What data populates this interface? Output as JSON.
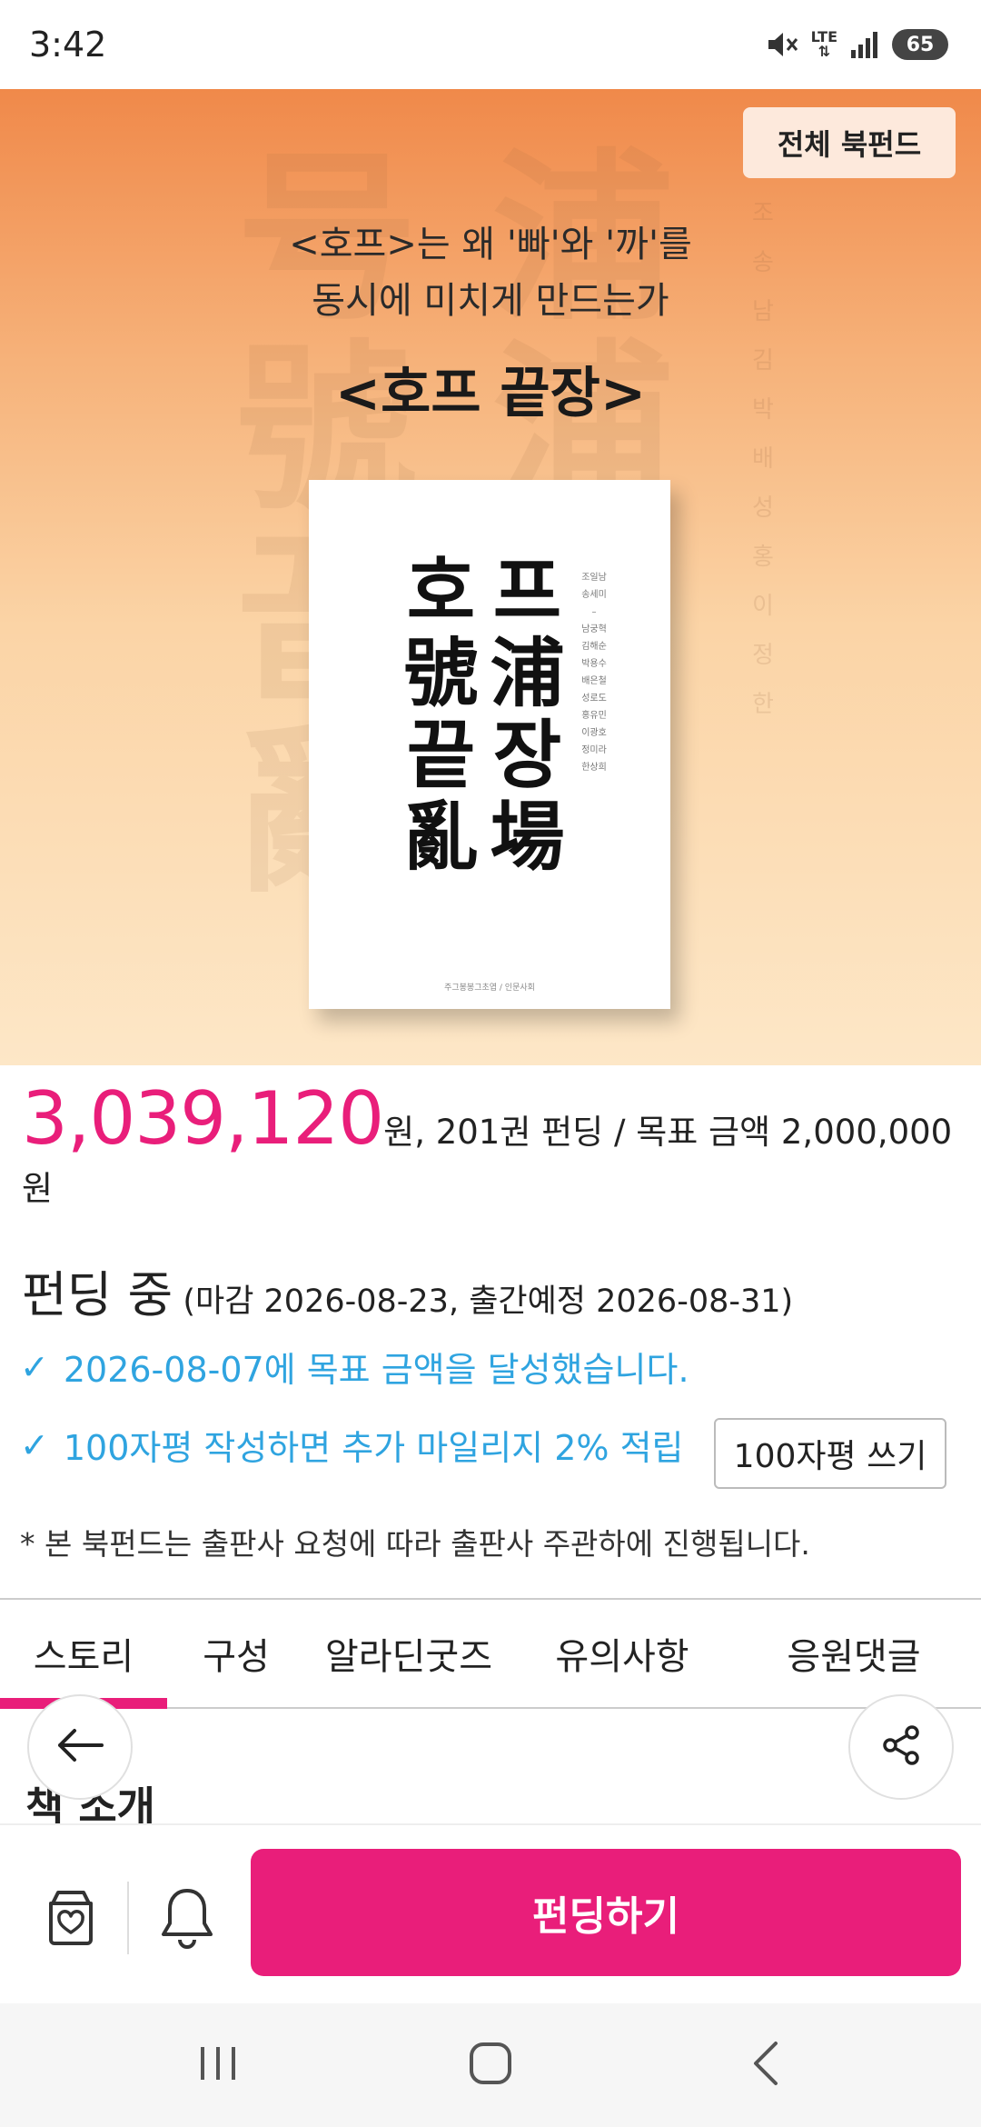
{
  "status_bar": {
    "time": "3:42",
    "network": "LTE",
    "battery": "65"
  },
  "hero": {
    "fund_all_button": "전체 북펀드",
    "subtitle_line1": "<호프>는 왜 '빠'와 '까'를",
    "subtitle_line2": "동시에 미치게 만드는가",
    "title": "<호프 끝장>",
    "cover": {
      "title_chars": [
        "호",
        "프",
        "號",
        "浦",
        "끝",
        "장",
        "亂",
        "場"
      ],
      "authors": [
        "조일남",
        "송세미",
        "남궁혁",
        "김해순",
        "박용수",
        "배은철",
        "성로도",
        "홍유민",
        "이광호",
        "정미라",
        "한상희"
      ],
      "publisher": "주그봉봉그초엽 / 인문사회"
    }
  },
  "funding": {
    "amount": "3,039,120",
    "amount_suffix": "원, 201권 펀딩 / 목표 금액 2,000,000원",
    "status": "펀딩 중",
    "dates": "(마감 2026-08-23, 출간예정 2026-08-31)",
    "goal_achieved": "2026-08-07에 목표 금액을 달성했습니다.",
    "review_bonus": "100자평 작성하면 추가 마일리지 2% 적립",
    "review_button": "100자평 쓰기",
    "notice": "* 본 북펀드는 출판사 요청에 따라 출판사 주관하에 진행됩니다."
  },
  "tabs": [
    {
      "label": "스토리",
      "active": true
    },
    {
      "label": "구성",
      "active": false
    },
    {
      "label": "알라딘굿즈",
      "active": false
    },
    {
      "label": "유의사항",
      "active": false
    },
    {
      "label": "응원댓글",
      "active": false
    }
  ],
  "section_title": "책 소개",
  "action_bar": {
    "fund_button": "펀딩하기",
    "icons": [
      "wishlist-bag-icon",
      "bell-icon"
    ]
  },
  "nav_bar": {
    "icons": [
      "recent-apps-icon",
      "home-icon",
      "back-icon"
    ]
  },
  "colors": {
    "accent": "#e91e7a",
    "info_blue": "#2fa4e0",
    "hero_top": "#f0894a",
    "hero_bottom": "#fde7c7"
  }
}
